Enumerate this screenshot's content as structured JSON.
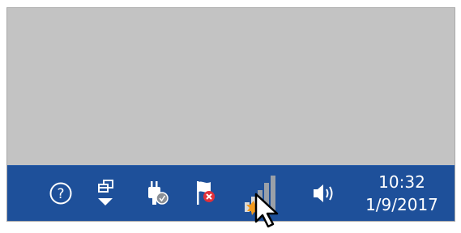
{
  "taskbar": {
    "tray_icons": [
      {
        "icon": "help-icon",
        "label": "?"
      },
      {
        "icon": "show-hidden-icons-icon"
      },
      {
        "icon": "power-plug-icon"
      },
      {
        "icon": "action-center-flag-icon",
        "status": "error"
      },
      {
        "icon": "network-signal-icon",
        "status": "warning"
      },
      {
        "icon": "volume-icon"
      }
    ],
    "clock": {
      "time": "10:32",
      "date": "1/9/2017"
    }
  },
  "colors": {
    "desktop": "#c3c3c3",
    "taskbar": "#1e509a",
    "icon": "#ffffff",
    "error": "#e0303a",
    "warning": "#f29a1e"
  }
}
